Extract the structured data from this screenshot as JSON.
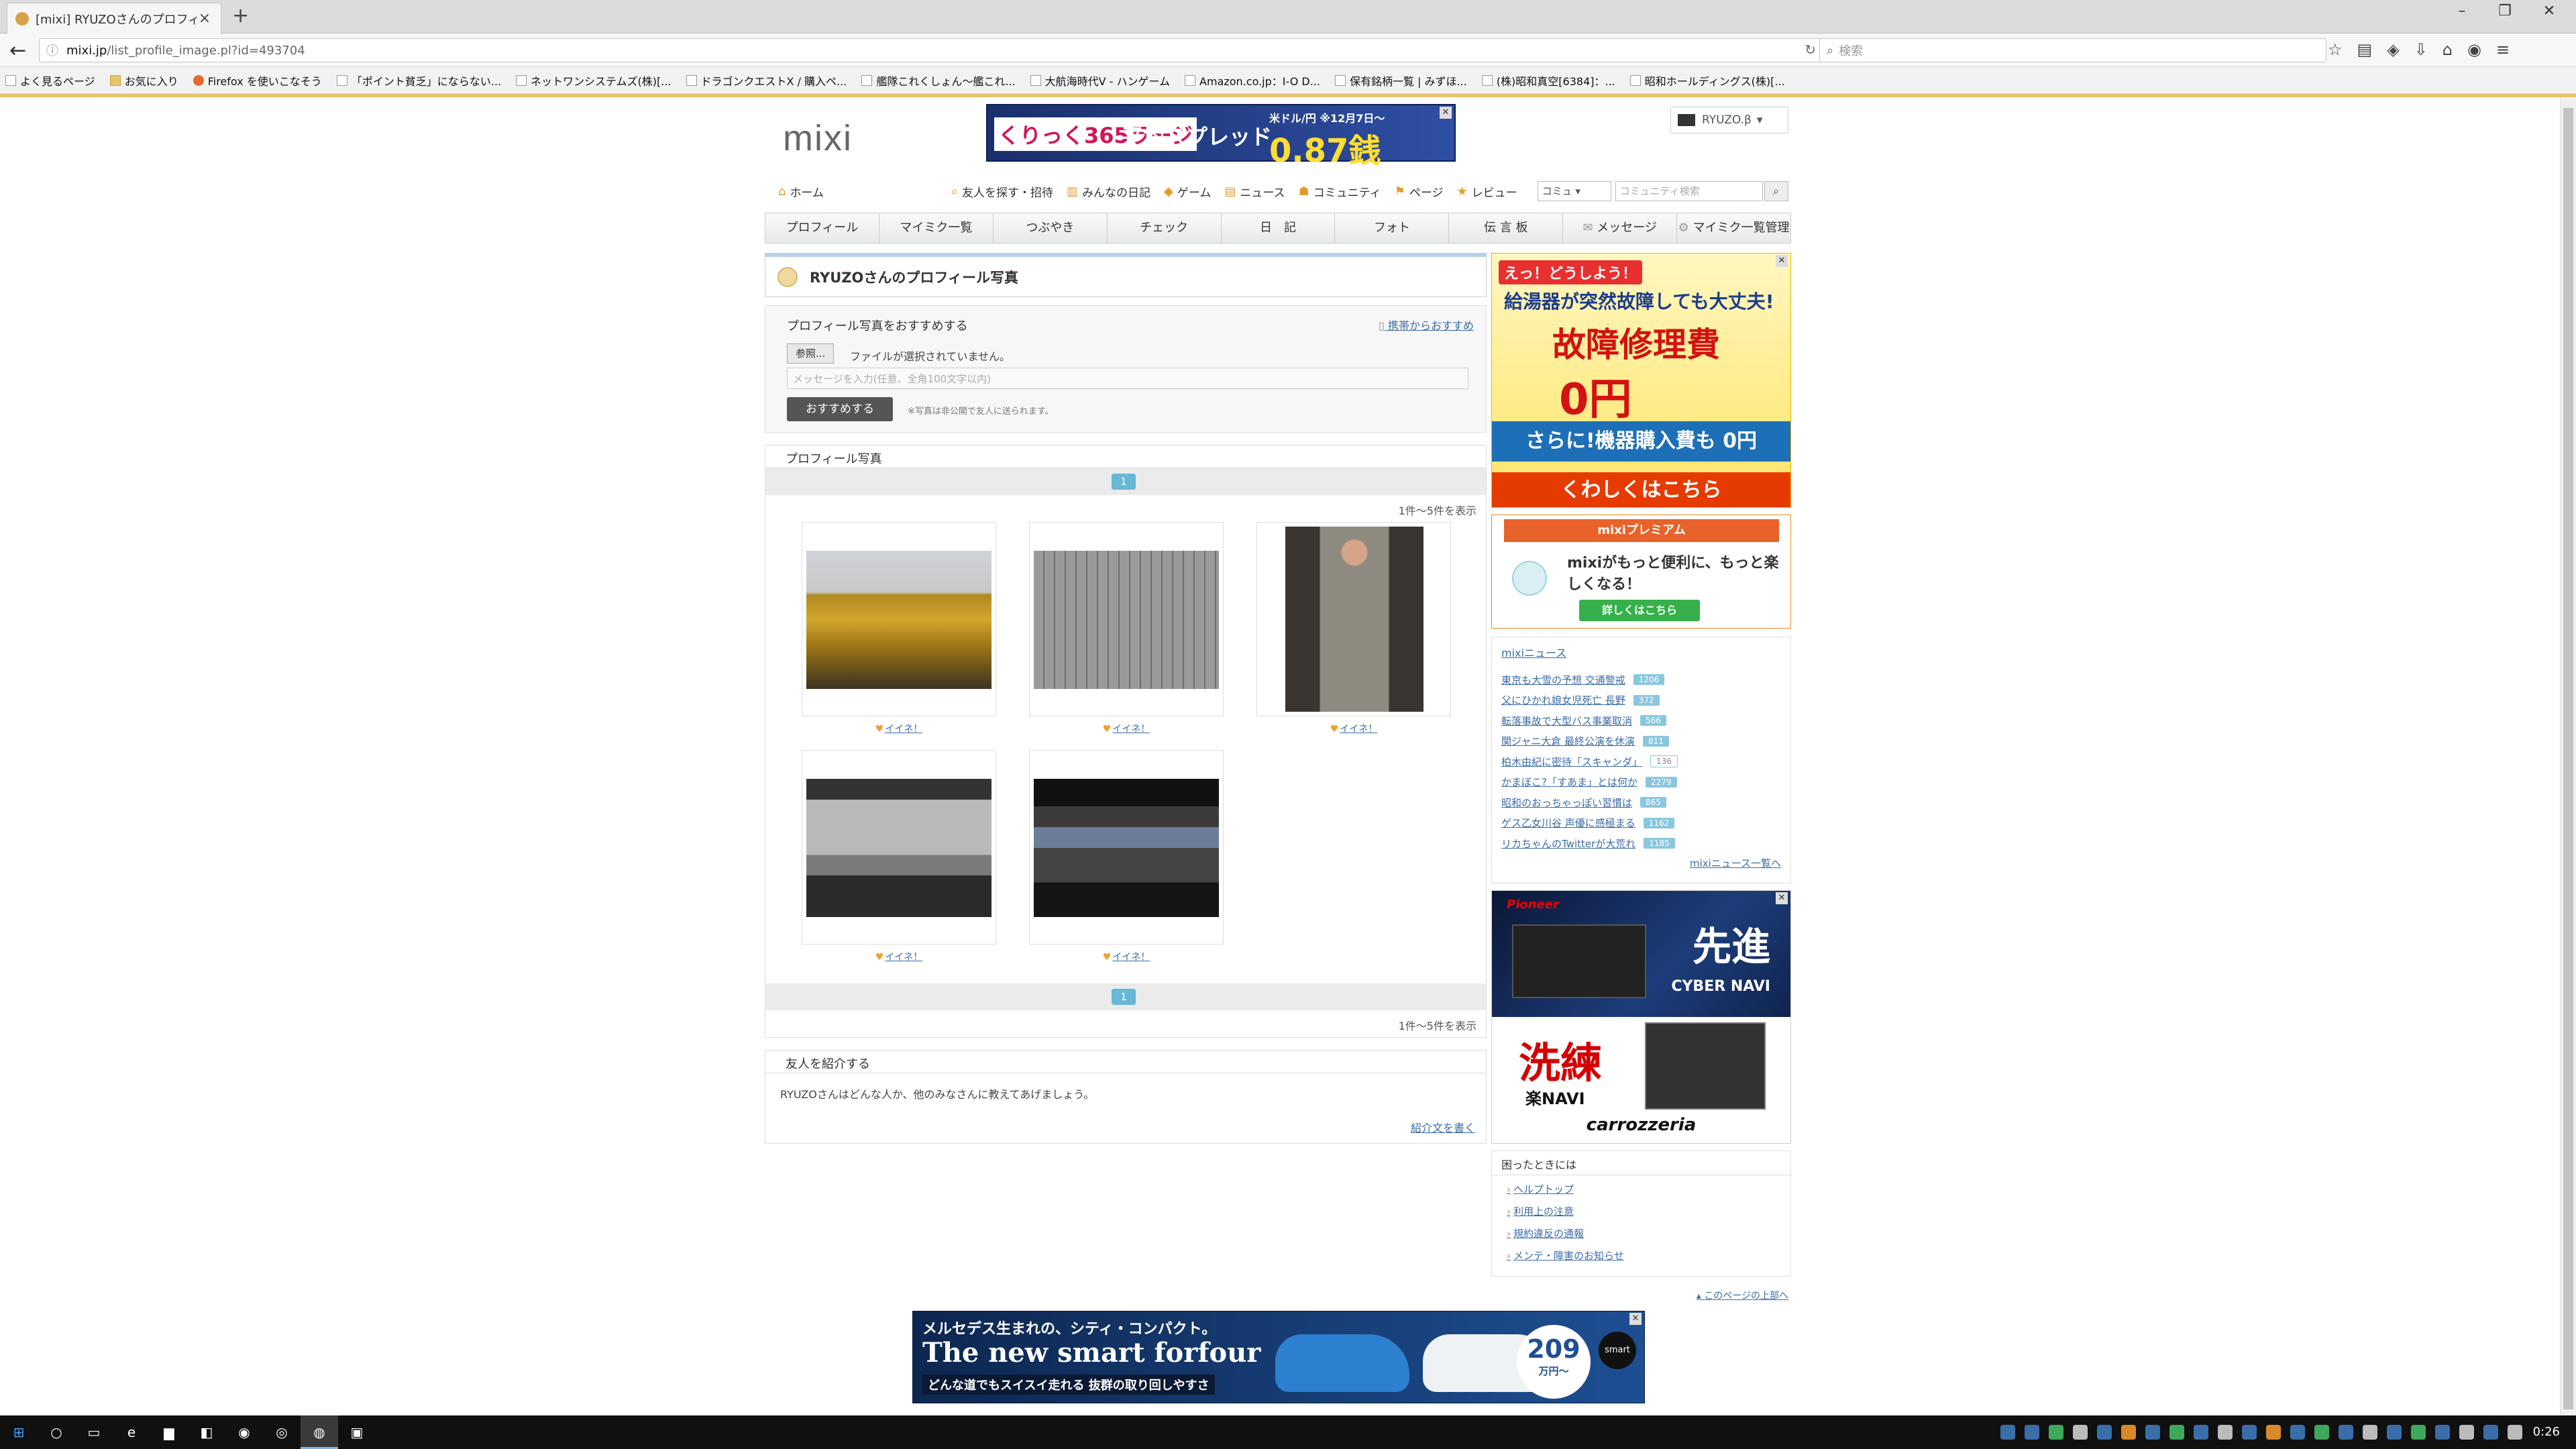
{
  "browser": {
    "tab_title": "[mixi] RYUZOさんのプロフィー...",
    "url_domain": "mixi.jp",
    "url_path": "/list_profile_image.pl?id=493704",
    "search_placeholder": "検索",
    "bookmarks": [
      "よく見るページ",
      "お気に入り",
      "Firefox を使いこなそう",
      "「ポイント貧乏」にならない...",
      "ネットワンシステムズ(株)[...",
      "ドラゴンクエストX / 購入ペ...",
      "艦隊これくしょん～艦これ...",
      "大航海時代Ⅴ - ハンゲーム",
      "Amazon.co.jp：I-O D...",
      "保有銘柄一覧 | みずほ...",
      "(株)昭和真空[6384]：...",
      "昭和ホールディングス(株)[..."
    ]
  },
  "header": {
    "logo": "mixi",
    "top_ad": {
      "brand": "くりっく365",
      "brand2": "ラージ",
      "headline": "平均スプレッド",
      "pair": "米ドル/円 ※12月7日〜",
      "value": "0.87銭"
    },
    "user_name": "RYUZO.β"
  },
  "global_nav": {
    "home": "ホーム",
    "items": [
      "友人を探す・招待",
      "みんなの日記",
      "ゲーム",
      "ニュース",
      "コミュニティ",
      "ページ",
      "レビュー"
    ],
    "scope_select": "コミュ",
    "search_placeholder": "コミュニティ検索"
  },
  "tabs": [
    "プロフィール",
    "マイミク一覧",
    "つぶやき",
    "チェック",
    "日　記",
    "フォト",
    "伝 言 板",
    "メッセージ",
    "マイミク一覧管理"
  ],
  "main": {
    "title": "RYUZOさんのプロフィール写真",
    "recommend": {
      "heading": "プロフィール写真をおすすめする",
      "mobile_link": "携帯からおすすめ",
      "file_button": "参照...",
      "file_status": "ファイルが選択されていません。",
      "message_placeholder": "メッセージを入力(任意、全角100文字以内)",
      "submit": "おすすめする",
      "note": "※写真は非公開で友人に送られます。"
    },
    "photos": {
      "heading": "プロフィール写真",
      "page": "1",
      "count": "1件〜5件を表示",
      "like_label": "イイネ！",
      "items": [
        {
          "name": "photo-beer-cans"
        },
        {
          "name": "photo-room"
        },
        {
          "name": "photo-person-coat"
        },
        {
          "name": "photo-av-amp-rack"
        },
        {
          "name": "photo-av-amp"
        }
      ]
    },
    "intro": {
      "heading": "友人を紹介する",
      "text": "RYUZOさんはどんな人か、他のみなさんに教えてあげましょう。",
      "link": "紹介文を書く"
    }
  },
  "sidebar": {
    "ad_boiler": {
      "tag": "えっ！どうしよう！",
      "line1": "給湯器が突然故障しても大丈夫!",
      "line2": "故障修理費",
      "line3": "0円",
      "line4": "さらに!機器購入費も 0円",
      "cta": "くわしくはこちら"
    },
    "premium": {
      "title": "mixiプレミアム",
      "text": "mixiがもっと便利に、もっと楽しくなる！",
      "button": "詳しくはこちら"
    },
    "news": {
      "heading": "mixiニュース",
      "items": [
        {
          "title": "東京も大雪の予想 交通警戒",
          "count": "1206"
        },
        {
          "title": "父にひかれ娘女児死亡 長野",
          "count": "372"
        },
        {
          "title": "転落事故で大型バス事業取消",
          "count": "566"
        },
        {
          "title": "関ジャニ大倉 最終公演を休演",
          "count": "811"
        },
        {
          "title": "柏木由紀に密待「スキャンダ」",
          "count": "136"
        },
        {
          "title": "かまぼこ?「すあま」とは何か",
          "count": "2279"
        },
        {
          "title": "昭和のおっちゃっぽい習慣は",
          "count": "865"
        },
        {
          "title": "ゲス乙女川谷 声優に感極まる",
          "count": "1162"
        },
        {
          "title": "リカちゃんのTwitterが大荒れ",
          "count": "1185"
        }
      ],
      "more": "mixiニュース一覧へ"
    },
    "ad_pioneer": {
      "brand": "Pioneer",
      "word1": "先進",
      "product1": "CYBER NAVI",
      "word2": "洗練",
      "product2": "楽NAVI",
      "logo": "carrozzeria"
    },
    "help": {
      "heading": "困ったときには",
      "items": [
        "ヘルプトップ",
        "利用上の注意",
        "規約違反の通報",
        "メンテ・障害のお知らせ"
      ]
    }
  },
  "footer": {
    "to_top": "このページの上部へ"
  },
  "bottom_ad": {
    "line1": "メルセデス生まれの、シティ・コンパクト。",
    "line2": "The new smart forfour",
    "line3": "どんな道でもスイスイ走れる 抜群の取り回しやすさ",
    "price": "209",
    "price_unit": "万円〜",
    "brand": "smart"
  },
  "taskbar": {
    "clock": "0:26"
  }
}
